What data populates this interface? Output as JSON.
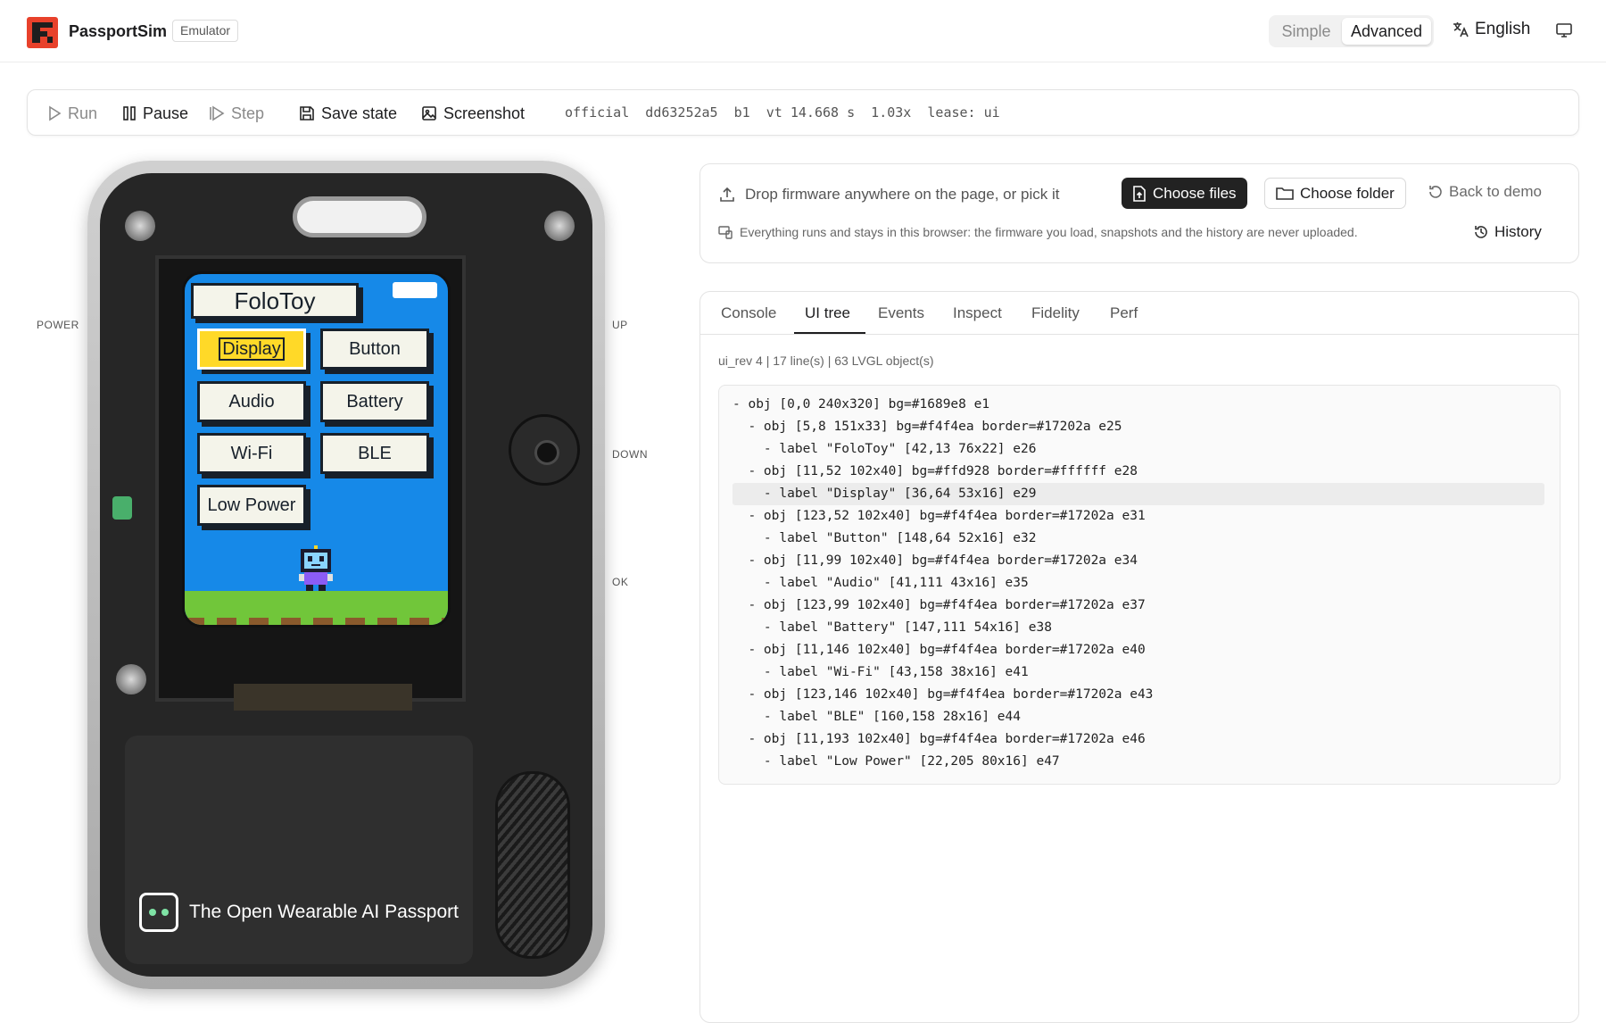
{
  "header": {
    "app_name": "PassportSim",
    "badge": "Emulator",
    "mode_simple": "Simple",
    "mode_advanced": "Advanced",
    "language": "English",
    "accent_color": "#e8412b"
  },
  "toolbar": {
    "run": "Run",
    "pause": "Pause",
    "step": "Step",
    "save_state": "Save state",
    "screenshot": "Screenshot",
    "status": "official  dd63252a5  b1  vt 14.668 s  1.03x  lease: ui"
  },
  "device": {
    "labels": {
      "power": "POWER",
      "up": "UP",
      "down": "DOWN",
      "ok": "OK"
    },
    "tagline": "The Open Wearable AI Passport",
    "screen": {
      "title": "FoloToy",
      "buttons": [
        "Display",
        "Button",
        "Audio",
        "Battery",
        "Wi-Fi",
        "BLE",
        "Low Power"
      ],
      "selected": "Display",
      "bg_color": "#1689e8"
    }
  },
  "upload": {
    "drop_text": "Drop firmware anywhere on the page, or pick it",
    "choose_files": "Choose files",
    "choose_folder": "Choose folder",
    "back_to_demo": "Back to demo",
    "privacy_note": "Everything runs and stays in this browser: the firmware you load, snapshots and the history are never uploaded.",
    "history": "History"
  },
  "panel": {
    "tabs": [
      "Console",
      "UI tree",
      "Events",
      "Inspect",
      "Fidelity",
      "Perf"
    ],
    "active_tab": "UI tree",
    "meta": "ui_rev 4 | 17 line(s) | 63 LVGL object(s)",
    "tree_lines": [
      "- obj [0,0 240x320] bg=#1689e8 e1",
      "  - obj [5,8 151x33] bg=#f4f4ea border=#17202a e25",
      "    - label \"FoloToy\" [42,13 76x22] e26",
      "  - obj [11,52 102x40] bg=#ffd928 border=#ffffff e28",
      "    - label \"Display\" [36,64 53x16] e29",
      "  - obj [123,52 102x40] bg=#f4f4ea border=#17202a e31",
      "    - label \"Button\" [148,64 52x16] e32",
      "  - obj [11,99 102x40] bg=#f4f4ea border=#17202a e34",
      "    - label \"Audio\" [41,111 43x16] e35",
      "  - obj [123,99 102x40] bg=#f4f4ea border=#17202a e37",
      "    - label \"Battery\" [147,111 54x16] e38",
      "  - obj [11,146 102x40] bg=#f4f4ea border=#17202a e40",
      "    - label \"Wi-Fi\" [43,158 38x16] e41",
      "  - obj [123,146 102x40] bg=#f4f4ea border=#17202a e43",
      "    - label \"BLE\" [160,158 28x16] e44",
      "  - obj [11,193 102x40] bg=#f4f4ea border=#17202a e46",
      "    - label \"Low Power\" [22,205 80x16] e47"
    ],
    "highlighted_line": 4
  }
}
